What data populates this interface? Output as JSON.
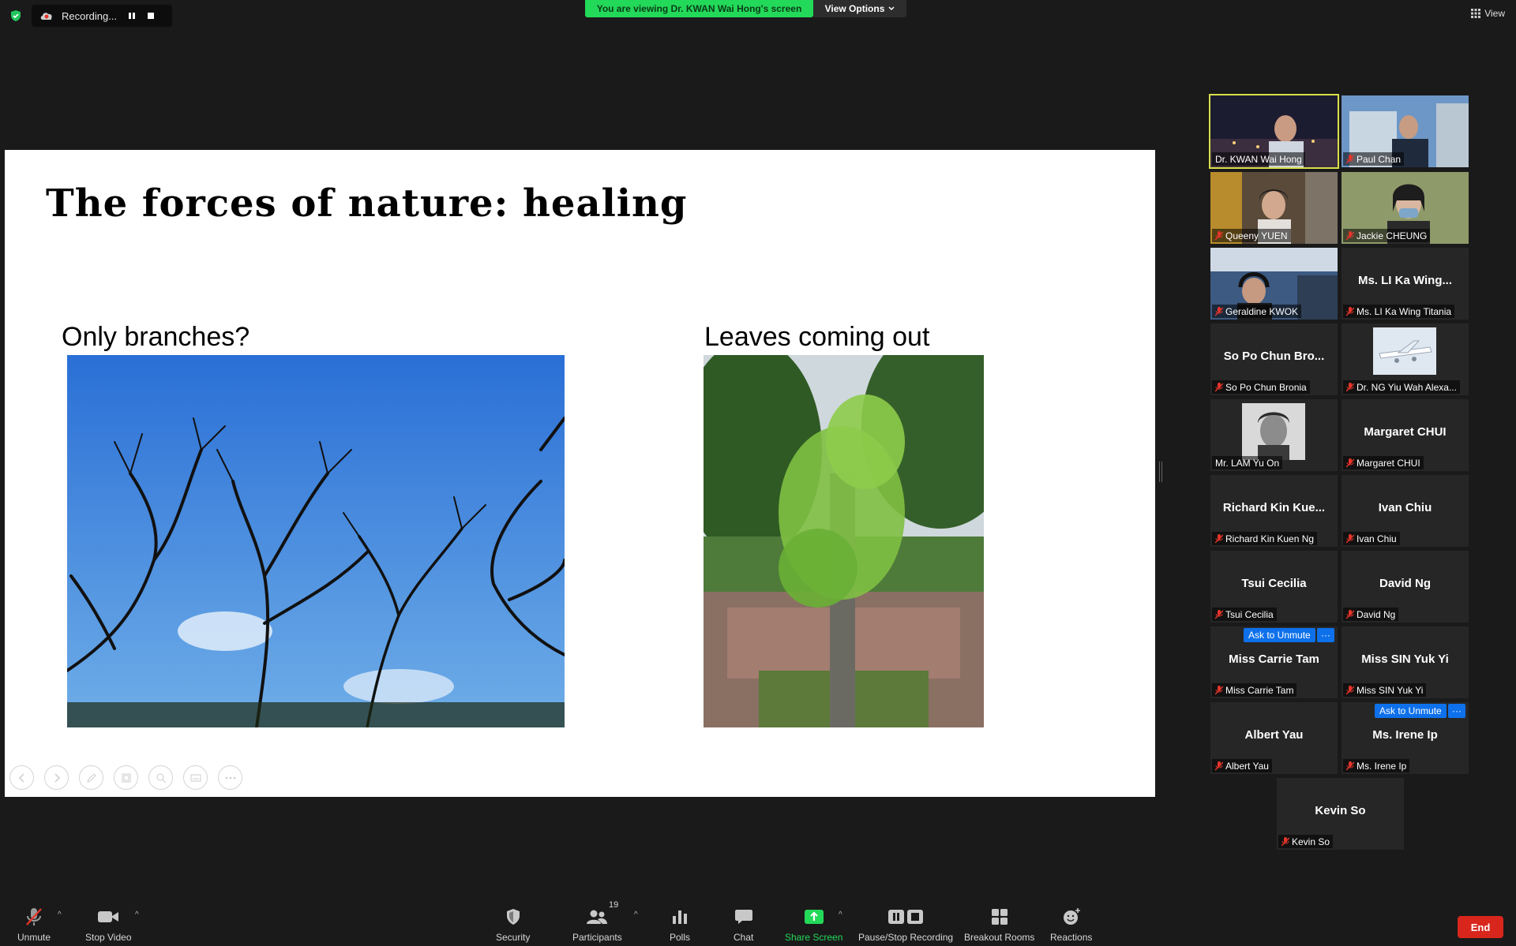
{
  "top_bar": {
    "recording_label": "Recording...",
    "viewing_banner": "You are viewing Dr. KWAN Wai Hong's screen",
    "view_options_label": "View Options",
    "view_label": "View"
  },
  "slide": {
    "title": "The forces of nature: healing",
    "left_caption": "Only branches?",
    "right_caption": "Leaves coming out"
  },
  "gallery": {
    "tiles": [
      {
        "name": "Dr. KWAN Wai Hong",
        "big": "",
        "muted": false,
        "video": true
      },
      {
        "name": "Paul Chan",
        "big": "",
        "muted": true,
        "video": true
      },
      {
        "name": "Queeny YUEN",
        "big": "",
        "muted": true,
        "video": true
      },
      {
        "name": "Jackie CHEUNG",
        "big": "",
        "muted": true,
        "video": true
      },
      {
        "name": "Geraldine KWOK",
        "big": "",
        "muted": true,
        "video": true
      },
      {
        "name": "Ms. LI Ka Wing Titania",
        "big": "Ms. LI Ka Wing...",
        "muted": true,
        "video": false
      },
      {
        "name": "So Po Chun Bronia",
        "big": "So Po Chun Bro...",
        "muted": true,
        "video": false
      },
      {
        "name": "Dr. NG Yiu Wah Alexa...",
        "big": "",
        "muted": true,
        "video": true
      },
      {
        "name": "Mr. LAM Yu On",
        "big": "",
        "muted": false,
        "video": true
      },
      {
        "name": "Margaret CHUI",
        "big": "Margaret CHUI",
        "muted": true,
        "video": false
      },
      {
        "name": "Richard Kin Kuen Ng",
        "big": "Richard Kin Kue...",
        "muted": true,
        "video": false
      },
      {
        "name": "Ivan Chiu",
        "big": "Ivan Chiu",
        "muted": true,
        "video": false
      },
      {
        "name": "Tsui Cecilia",
        "big": "Tsui Cecilia",
        "muted": true,
        "video": false
      },
      {
        "name": "David Ng",
        "big": "David Ng",
        "muted": true,
        "video": false
      },
      {
        "name": "Miss Carrie Tam",
        "big": "Miss Carrie Tam",
        "muted": true,
        "video": false
      },
      {
        "name": "Miss SIN Yuk Yi",
        "big": "Miss SIN Yuk Yi",
        "muted": true,
        "video": false
      },
      {
        "name": "Albert Yau",
        "big": "Albert Yau",
        "muted": true,
        "video": false
      },
      {
        "name": "Ms. Irene Ip",
        "big": "Ms. Irene Ip",
        "muted": true,
        "video": false
      },
      {
        "name": "Kevin So",
        "big": "Kevin So",
        "muted": true,
        "video": false
      }
    ],
    "ask_to_unmute": "Ask to Unmute",
    "more": "···"
  },
  "toolbar": {
    "unmute": "Unmute",
    "stop_video": "Stop Video",
    "security": "Security",
    "participants": "Participants",
    "participants_count": "19",
    "polls": "Polls",
    "chat": "Chat",
    "share_screen": "Share Screen",
    "pause_stop_recording": "Pause/Stop Recording",
    "breakout_rooms": "Breakout Rooms",
    "reactions": "Reactions",
    "end": "End"
  },
  "colors": {
    "banner_green": "#23d959",
    "active_speaker": "#d8e04a",
    "end_red": "#d9261c",
    "accent_blue": "#0e71eb"
  }
}
